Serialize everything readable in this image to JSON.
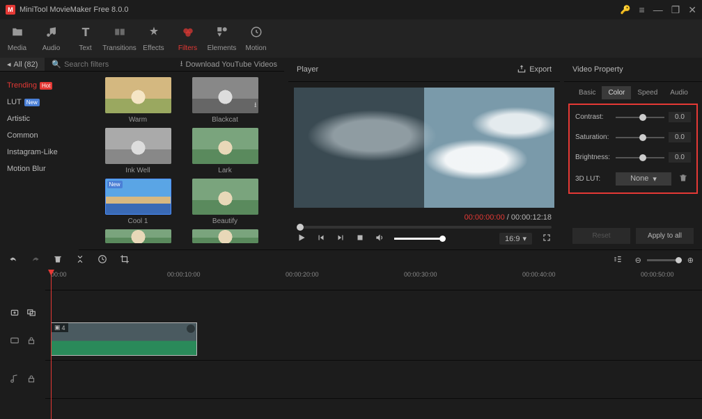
{
  "app": {
    "title": "MiniTool MovieMaker Free 8.0.0"
  },
  "toolbar": {
    "items": [
      {
        "label": "Media",
        "icon": "folder"
      },
      {
        "label": "Audio",
        "icon": "music"
      },
      {
        "label": "Text",
        "icon": "text"
      },
      {
        "label": "Transitions",
        "icon": "trans"
      },
      {
        "label": "Effects",
        "icon": "fx"
      },
      {
        "label": "Filters",
        "icon": "filter",
        "active": true
      },
      {
        "label": "Elements",
        "icon": "shapes"
      },
      {
        "label": "Motion",
        "icon": "motion"
      }
    ]
  },
  "filter_panel": {
    "all_label": "All (82)",
    "search_placeholder": "Search filters",
    "download_label": "Download YouTube Videos",
    "categories": [
      {
        "name": "Trending",
        "badge": "Hot",
        "active": true
      },
      {
        "name": "LUT",
        "badge": "New"
      },
      {
        "name": "Artistic"
      },
      {
        "name": "Common"
      },
      {
        "name": "Instagram-Like"
      },
      {
        "name": "Motion Blur"
      }
    ],
    "items": [
      {
        "name": "Warm",
        "cls": "warm"
      },
      {
        "name": "Blackcat",
        "cls": "black",
        "dl": true
      },
      {
        "name": "Ink Well",
        "cls": "ink"
      },
      {
        "name": "Lark",
        "cls": ""
      },
      {
        "name": "Cool 1",
        "cls": "cool",
        "new": true
      },
      {
        "name": "Beautify",
        "cls": ""
      }
    ]
  },
  "player": {
    "title": "Player",
    "export": "Export",
    "current_time": "00:00:00:00",
    "total_time": "00:00:12:18",
    "aspect": "16:9"
  },
  "properties": {
    "title": "Video Property",
    "tabs": [
      "Basic",
      "Color",
      "Speed",
      "Audio"
    ],
    "active_tab": "Color",
    "contrast_label": "Contrast:",
    "contrast_val": "0.0",
    "saturation_label": "Saturation:",
    "saturation_val": "0.0",
    "brightness_label": "Brightness:",
    "brightness_val": "0.0",
    "lut_label": "3D LUT:",
    "lut_value": "None",
    "reset": "Reset",
    "apply": "Apply to all"
  },
  "timeline": {
    "marks": [
      "00:00",
      "00:00:10:00",
      "00:00:20:00",
      "00:00:30:00",
      "00:00:40:00",
      "00:00:50:00"
    ],
    "clip_label": "4"
  }
}
